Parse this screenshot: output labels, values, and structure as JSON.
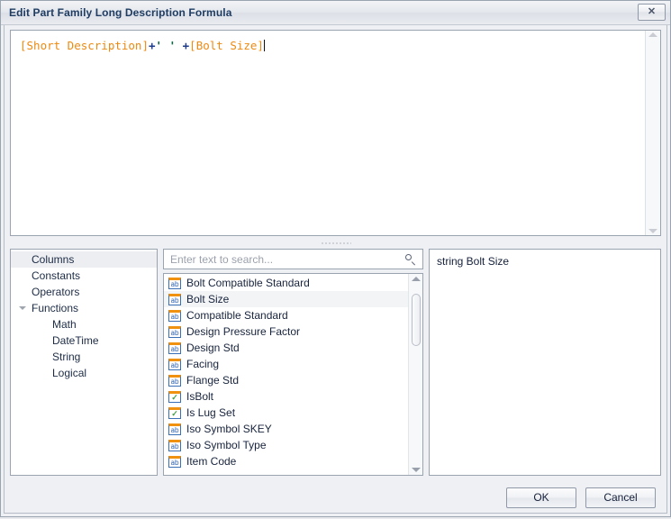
{
  "window": {
    "title": "Edit Part Family Long Description Formula",
    "close_label": "✕"
  },
  "editor": {
    "tokens": [
      {
        "text": "[Short Description]",
        "type": "field"
      },
      {
        "text": "+",
        "type": "op"
      },
      {
        "text": "' '",
        "type": "string"
      },
      {
        "text": " +",
        "type": "op"
      },
      {
        "text": "[Bolt Size]",
        "type": "field"
      }
    ],
    "full_text": "[Short Description]+' ' +[Bolt Size]",
    "colors": {
      "field": "#ec8a12",
      "operator": "#1f3c8c",
      "string": "#0f6b45"
    }
  },
  "tree": {
    "items": [
      {
        "label": "Columns",
        "level": 0,
        "selected": true,
        "expander": false
      },
      {
        "label": "Constants",
        "level": 0,
        "selected": false,
        "expander": false
      },
      {
        "label": "Operators",
        "level": 0,
        "selected": false,
        "expander": false
      },
      {
        "label": "Functions",
        "level": 0,
        "selected": false,
        "expander": true
      },
      {
        "label": "Math",
        "level": 1,
        "selected": false,
        "expander": false
      },
      {
        "label": "DateTime",
        "level": 1,
        "selected": false,
        "expander": false
      },
      {
        "label": "String",
        "level": 1,
        "selected": false,
        "expander": false
      },
      {
        "label": "Logical",
        "level": 1,
        "selected": false,
        "expander": false
      }
    ]
  },
  "search": {
    "value": "",
    "placeholder": "Enter text to search...",
    "icon": "search-icon"
  },
  "list": {
    "items": [
      {
        "label": "Bolt Compatible Standard",
        "icon": "string-field-icon",
        "type": "string",
        "selected": false
      },
      {
        "label": "Bolt Size",
        "icon": "string-field-icon",
        "type": "string",
        "selected": true
      },
      {
        "label": "Compatible Standard",
        "icon": "string-field-icon",
        "type": "string",
        "selected": false
      },
      {
        "label": "Design Pressure Factor",
        "icon": "string-field-icon",
        "type": "string",
        "selected": false
      },
      {
        "label": "Design Std",
        "icon": "string-field-icon",
        "type": "string",
        "selected": false
      },
      {
        "label": "Facing",
        "icon": "string-field-icon",
        "type": "string",
        "selected": false
      },
      {
        "label": "Flange Std",
        "icon": "string-field-icon",
        "type": "string",
        "selected": false
      },
      {
        "label": "IsBolt",
        "icon": "boolean-field-icon",
        "type": "boolean",
        "selected": false
      },
      {
        "label": "Is Lug Set",
        "icon": "boolean-field-icon",
        "type": "boolean",
        "selected": false
      },
      {
        "label": "Iso Symbol SKEY",
        "icon": "string-field-icon",
        "type": "string",
        "selected": false
      },
      {
        "label": "Iso Symbol Type",
        "icon": "string-field-icon",
        "type": "string",
        "selected": false
      },
      {
        "label": "Item Code",
        "icon": "string-field-icon",
        "type": "string",
        "selected": false
      }
    ],
    "glyph_string": "ab",
    "glyph_boolean": "✓"
  },
  "info": {
    "description": "string Bolt Size"
  },
  "footer": {
    "ok_label": "OK",
    "cancel_label": "Cancel"
  }
}
